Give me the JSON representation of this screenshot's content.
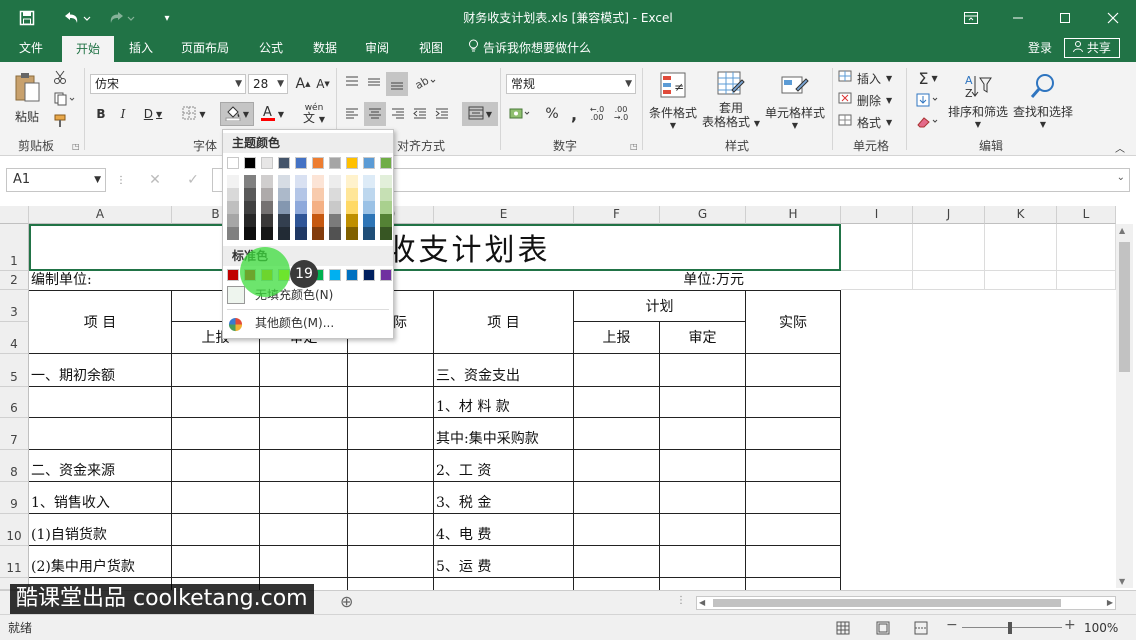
{
  "window": {
    "title": "财务收支计划表.xls  [兼容模式] - Excel"
  },
  "quick_access": {
    "save_icon": "save-icon",
    "undo_icon": "undo-icon",
    "redo_icon": "redo-icon",
    "customize_icon": "customize-qat-icon"
  },
  "window_controls": {
    "restore_ribbon": "ribbon-display-icon",
    "minimize": "minimize-icon",
    "maximize": "maximize-icon",
    "close": "close-icon"
  },
  "tabs": [
    {
      "label": "文件"
    },
    {
      "label": "开始"
    },
    {
      "label": "插入"
    },
    {
      "label": "页面布局"
    },
    {
      "label": "公式"
    },
    {
      "label": "数据"
    },
    {
      "label": "审阅"
    },
    {
      "label": "视图"
    }
  ],
  "tell_me": "告诉我你想要做什么",
  "account": {
    "login": "登录",
    "share": "共享"
  },
  "ribbon": {
    "clipboard": {
      "paste": "粘贴",
      "label": "剪贴板"
    },
    "font": {
      "name": "仿宋",
      "size": "28",
      "bold": "B",
      "italic": "I",
      "underline": "D",
      "phonetic": "wén",
      "label": "字体"
    },
    "alignment": {
      "label": "对齐方式"
    },
    "number": {
      "format": "常规",
      "percent": "%",
      "comma": ",",
      "label": "数字"
    },
    "styles": {
      "conditional": "条件格式",
      "table1": "套用",
      "table2": "表格格式",
      "cell_styles": "单元格样式",
      "label": "样式"
    },
    "cells": {
      "insert": "插入",
      "delete": "删除",
      "format": "格式",
      "label": "单元格"
    },
    "editing": {
      "sort": "排序和筛选",
      "find": "查找和选择",
      "label": "编辑"
    }
  },
  "formula_bar": {
    "name_box": "A1",
    "cancel": "✕",
    "enter": "✓"
  },
  "color_dropdown": {
    "theme_header": "主题颜色",
    "standard_header": "标准色",
    "no_fill": "无填充颜色(N)",
    "more_colors": "其他颜色(M)...",
    "step_badge": "19",
    "theme_top": [
      "#ffffff",
      "#000000",
      "#e7e6e6",
      "#44546a",
      "#4472c4",
      "#ed7d31",
      "#a5a5a5",
      "#ffc000",
      "#5b9bd5",
      "#70ad47"
    ],
    "theme_shades": [
      [
        "#f2f2f2",
        "#808080",
        "#d0cece",
        "#d6dce4",
        "#d9e1f2",
        "#fce4d6",
        "#ededed",
        "#fff2cc",
        "#ddebf7",
        "#e2efda"
      ],
      [
        "#d9d9d9",
        "#595959",
        "#aeaaaa",
        "#acb9ca",
        "#b4c6e7",
        "#f8cbad",
        "#dbdbdb",
        "#ffe699",
        "#bdd7ee",
        "#c6e0b4"
      ],
      [
        "#bfbfbf",
        "#404040",
        "#757171",
        "#8497b0",
        "#8ea9db",
        "#f4b084",
        "#c9c9c9",
        "#ffd966",
        "#9bc2e6",
        "#a9d08e"
      ],
      [
        "#a6a6a6",
        "#262626",
        "#3a3838",
        "#333f4f",
        "#2f5597",
        "#c65911",
        "#7b7b7b",
        "#bf8f00",
        "#2e75b6",
        "#548235"
      ],
      [
        "#808080",
        "#0d0d0d",
        "#161616",
        "#222b35",
        "#1f3864",
        "#833c0c",
        "#525252",
        "#806000",
        "#1f4e78",
        "#375623"
      ]
    ],
    "standard": [
      "#c00000",
      "#ff0000",
      "#ffc000",
      "#ffff00",
      "#92d050",
      "#00b050",
      "#00b0f0",
      "#0070c0",
      "#002060",
      "#7030a0"
    ]
  },
  "sheet": {
    "columns": [
      "A",
      "B",
      "C",
      "D",
      "E",
      "F",
      "G",
      "H",
      "I",
      "J",
      "K",
      "L"
    ],
    "rows": [
      "1",
      "2",
      "3",
      "4",
      "5",
      "6",
      "7",
      "8",
      "9",
      "10",
      "11"
    ],
    "title": "财务收支计划表",
    "title_visible": "收支计划表",
    "unit_left": "编制单位:",
    "unit_right": "单位:万元",
    "header": {
      "item": "项        目",
      "report": "上报",
      "approve": "审定",
      "actual": "实际",
      "actual_partial": "际",
      "plan": "计划"
    },
    "left_items": [
      "一、期初余额",
      "",
      "",
      "二、资金来源",
      "1、销售收入",
      "(1)自销货款",
      "(2)集中用户货款"
    ],
    "right_items": [
      "三、资金支出",
      "1、材 料 款",
      "其中:集中采购款",
      "2、工    资",
      "3、税    金",
      "4、电    费",
      "5、运    费"
    ]
  },
  "sheet_tabs": {
    "add": "⊕"
  },
  "status": {
    "ready": "就绪",
    "zoom": "100%"
  },
  "watermark": "酷课堂出品 coolketang.com"
}
